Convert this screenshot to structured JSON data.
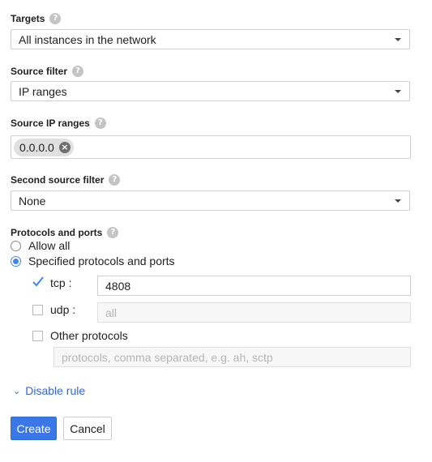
{
  "targets": {
    "label": "Targets",
    "value": "All instances in the network"
  },
  "source_filter": {
    "label": "Source filter",
    "value": "IP ranges"
  },
  "source_ip_ranges": {
    "label": "Source IP ranges",
    "chips": [
      "0.0.0.0"
    ]
  },
  "second_source_filter": {
    "label": "Second source filter",
    "value": "None"
  },
  "protocols": {
    "label": "Protocols and ports",
    "allow_all_label": "Allow all",
    "specified_label": "Specified protocols and ports",
    "selected": "specified",
    "tcp": {
      "label": "tcp :",
      "checked": true,
      "value": "4808"
    },
    "udp": {
      "label": "udp :",
      "checked": false,
      "placeholder": "all"
    },
    "other": {
      "label": "Other protocols",
      "checked": false,
      "placeholder": "protocols, comma separated, e.g. ah, sctp"
    }
  },
  "disable_rule": {
    "label": "Disable rule"
  },
  "buttons": {
    "create": "Create",
    "cancel": "Cancel"
  },
  "colors": {
    "accent": "#3b78e7",
    "link": "#3367d6",
    "radio": "#4285f4"
  },
  "icons": {
    "help": "help-circle-icon",
    "dropdown": "caret-down-icon",
    "chip_remove": "remove-chip-icon",
    "check": "check-icon",
    "expand": "double-chevron-down-icon"
  }
}
